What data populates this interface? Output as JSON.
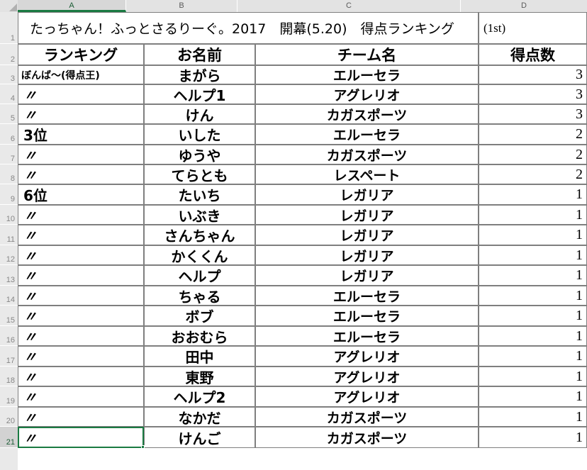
{
  "app": {
    "type": "spreadsheet",
    "selected_cell": "A21"
  },
  "column_headers": [
    {
      "label": "A",
      "active": true
    },
    {
      "label": "B",
      "active": false
    },
    {
      "label": "C",
      "active": false
    },
    {
      "label": "D",
      "active": false
    }
  ],
  "row_headers": [
    "1",
    "2",
    "3",
    "4",
    "5",
    "6",
    "7",
    "8",
    "9",
    "10",
    "11",
    "12",
    "13",
    "14",
    "15",
    "16",
    "17",
    "18",
    "19",
    "20",
    "21"
  ],
  "title": {
    "main": "たっちゃん！ふっとさるりーぐ。2017　開幕(5.20)　得点ランキング",
    "note": "(1st)"
  },
  "table": {
    "headers": [
      "ランキング",
      "お名前",
      "チーム名",
      "得点数"
    ],
    "rows": [
      {
        "rank": "ぼんば～(得点王)",
        "name": "まがら",
        "team": "エルーセラ",
        "score": "3"
      },
      {
        "rank": "〃",
        "name": "ヘルプ1",
        "team": "アグレリオ",
        "score": "3"
      },
      {
        "rank": "〃",
        "name": "けん",
        "team": "カガスポーツ",
        "score": "3"
      },
      {
        "rank": "3位",
        "name": "いした",
        "team": "エルーセラ",
        "score": "2"
      },
      {
        "rank": "〃",
        "name": "ゆうや",
        "team": "カガスポーツ",
        "score": "2"
      },
      {
        "rank": "〃",
        "name": "てらとも",
        "team": "レスペート",
        "score": "2"
      },
      {
        "rank": "6位",
        "name": "たいち",
        "team": "レガリア",
        "score": "1"
      },
      {
        "rank": "〃",
        "name": "いぶき",
        "team": "レガリア",
        "score": "1"
      },
      {
        "rank": "〃",
        "name": "さんちゃん",
        "team": "レガリア",
        "score": "1"
      },
      {
        "rank": "〃",
        "name": "かくくん",
        "team": "レガリア",
        "score": "1"
      },
      {
        "rank": "〃",
        "name": "ヘルプ",
        "team": "レガリア",
        "score": "1"
      },
      {
        "rank": "〃",
        "name": "ちゃる",
        "team": "エルーセラ",
        "score": "1"
      },
      {
        "rank": "〃",
        "name": "ボブ",
        "team": "エルーセラ",
        "score": "1"
      },
      {
        "rank": "〃",
        "name": "おおむら",
        "team": "エルーセラ",
        "score": "1"
      },
      {
        "rank": "〃",
        "name": "田中",
        "team": "アグレリオ",
        "score": "1"
      },
      {
        "rank": "〃",
        "name": "東野",
        "team": "アグレリオ",
        "score": "1"
      },
      {
        "rank": "〃",
        "name": "ヘルプ2",
        "team": "アグレリオ",
        "score": "1"
      },
      {
        "rank": "〃",
        "name": "なかだ",
        "team": "カガスポーツ",
        "score": "1"
      },
      {
        "rank": "〃",
        "name": "けんご",
        "team": "カガスポーツ",
        "score": "1"
      }
    ]
  },
  "colors": {
    "grid_line": "#7f7f7f",
    "header_bg": "#e3e3e3",
    "selection": "#1a7a42"
  }
}
